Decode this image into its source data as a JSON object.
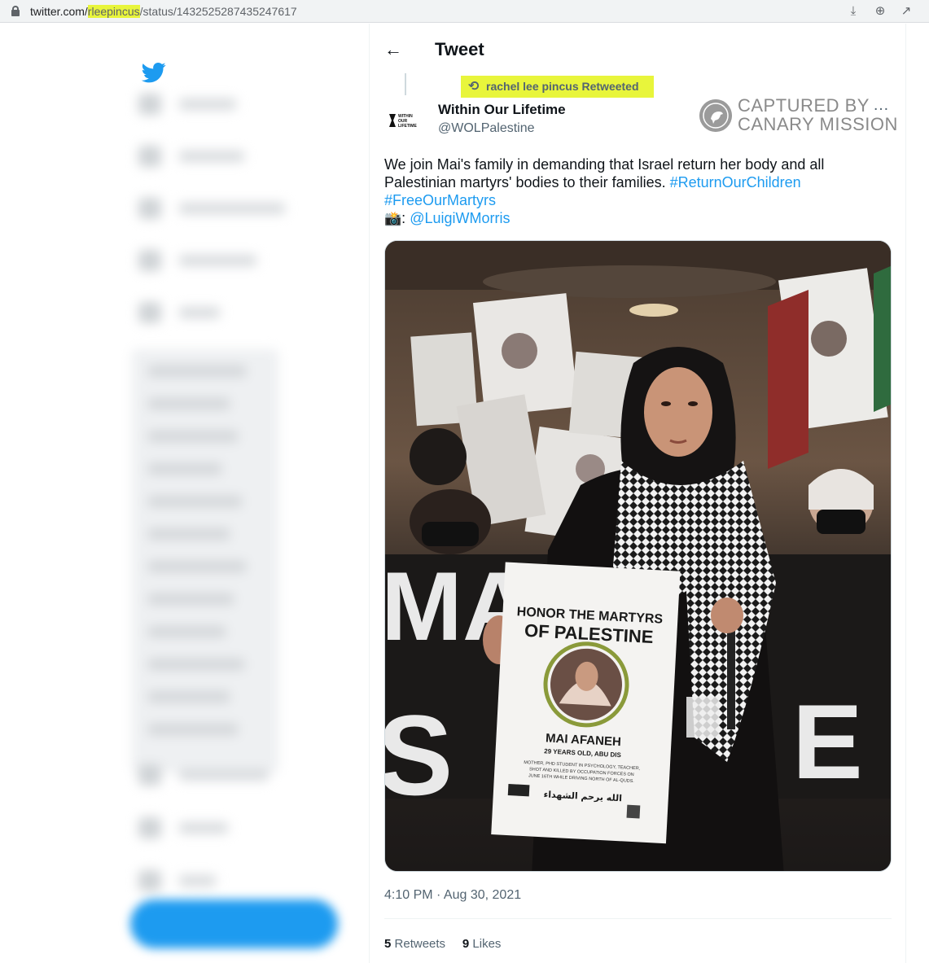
{
  "browser": {
    "url_host": "twitter.com/",
    "url_user": "rleepincus",
    "url_path": "/status/1432525287435247617"
  },
  "header": {
    "title": "Tweet"
  },
  "retweet": {
    "label": "rachel lee pincus Retweeted"
  },
  "author": {
    "name": "Within Our Lifetime",
    "handle": "@WOLPalestine",
    "avatar_text": [
      "WITHIN",
      "OUR",
      "LIFETIME"
    ]
  },
  "watermark": {
    "line1": "CAPTURED BY",
    "line2": "CANARY MISSION"
  },
  "tweet": {
    "text_1": "We join Mai's family in demanding that Israel return her body and all Palestinian martyrs' bodies to their families. ",
    "hashtag_1": "#ReturnOurChildren",
    "hashtag_2": "#FreeOurMartyrs",
    "camera": "📸",
    "colon": ": ",
    "mention": "@LuigiWMorris",
    "timestamp": "4:10 PM · Aug 30, 2021"
  },
  "photo": {
    "poster_heading_1": "HONOR THE MARTYRS",
    "poster_heading_2": "OF PALESTINE",
    "poster_name": "MAI AFANEH",
    "poster_sub": "29 YEARS OLD, ABU DIS",
    "poster_desc_1": "MOTHER, PHD STUDENT IN PSYCHOLOGY, TEACHER,",
    "poster_desc_2": "SHOT AND KILLED BY OCCUPATION FORCES ON",
    "poster_desc_3": "JUNE 16TH WHILE DRIVING NORTH OF AL-QUDS.",
    "poster_arabic": "الله يرحم الشهداء"
  },
  "stats": {
    "retweets_count": "5",
    "retweets_label": "Retweets",
    "likes_count": "9",
    "likes_label": "Likes"
  },
  "colors": {
    "twitter_blue": "#1d9bf0",
    "highlight": "#e8f53b",
    "secondary_text": "#536471"
  }
}
